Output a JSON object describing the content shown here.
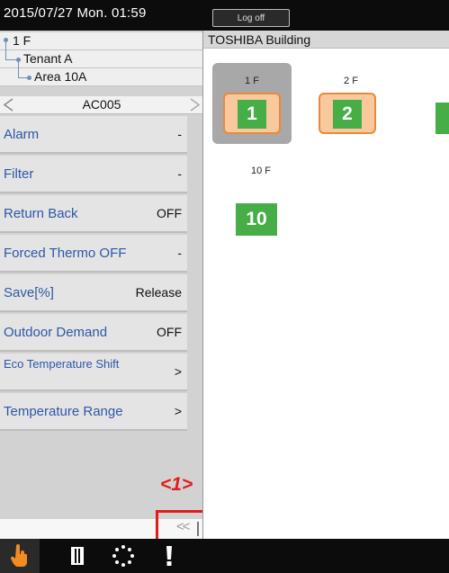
{
  "topbar": {
    "datetime": "2015/07/27  Mon.  01:59",
    "logoff_label": "Log off"
  },
  "tree": {
    "level1": "1 F",
    "level2": "Tenant A",
    "level3": "Area 10A"
  },
  "unit": {
    "name": "AC005"
  },
  "menu": [
    {
      "label": "Alarm",
      "value": "-"
    },
    {
      "label": "Filter",
      "value": "-"
    },
    {
      "label": "Return Back",
      "value": "OFF"
    },
    {
      "label": "Forced Thermo OFF",
      "value": "-"
    },
    {
      "label": "Save[%]",
      "value": "Release"
    },
    {
      "label": "Outdoor Demand",
      "value": "OFF"
    },
    {
      "label": "Eco Temperature Shift",
      "value": ">"
    },
    {
      "label": "Temperature Range",
      "value": ">"
    }
  ],
  "collapse": {
    "glyph": "<<"
  },
  "callout": {
    "label": "<1>"
  },
  "building": {
    "title": "TOSHIBA Building",
    "floors": [
      {
        "label": "1 F",
        "number": "1",
        "selected": true
      },
      {
        "label": "2 F",
        "number": "2",
        "selected": false
      },
      {
        "label": "10 F",
        "number": "10",
        "selected": false
      }
    ]
  },
  "bottombar": {
    "icons": [
      "hand-pointer-icon",
      "schedule-icon",
      "circle-dots-icon",
      "exclamation-icon"
    ]
  },
  "colors": {
    "accent_text": "#2e57a6",
    "floor_green": "#47ad46",
    "tile_orange": "#e88a3a",
    "callout_red": "#e21c1c"
  }
}
